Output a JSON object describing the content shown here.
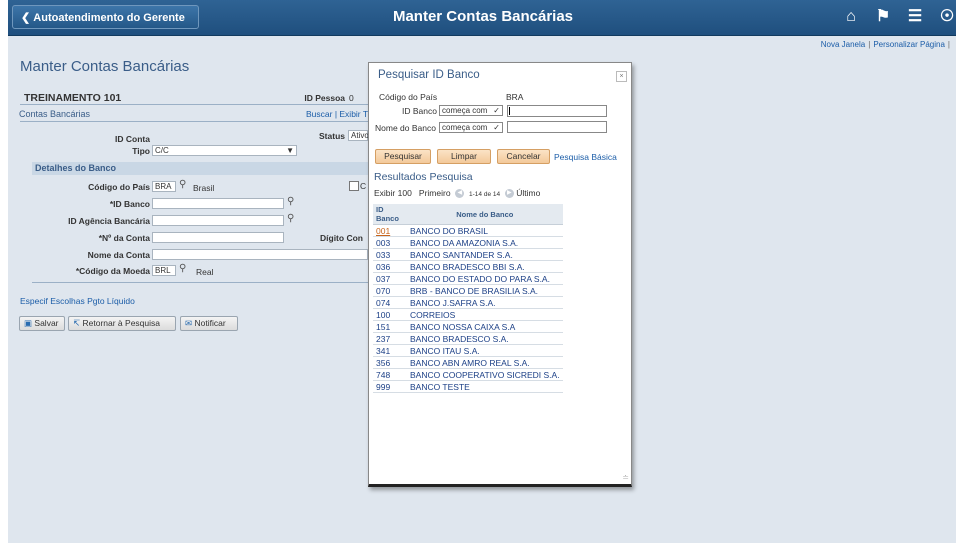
{
  "header": {
    "back_label": "Autoatendimento do Gerente",
    "title": "Manter Contas Bancárias",
    "icons": [
      "home-icon",
      "flag-icon",
      "menu-icon",
      "compass-icon"
    ]
  },
  "toplinks": {
    "new_window": "Nova Janela",
    "personalize": "Personalizar Página"
  },
  "page": {
    "title": "Manter Contas Bancárias",
    "person_name": "TREINAMENTO 101",
    "person_id_label": "ID Pessoa",
    "person_id_value": "0",
    "section_title": "Contas Bancárias",
    "section_links": "Buscar | Exibir T",
    "account_id_label": "ID Conta",
    "status_label": "Status",
    "status_value": "Ativo",
    "type_label": "Tipo",
    "type_value": "C/C",
    "bank_details_title": "Detalhes do Banco",
    "country_label": "Código do País",
    "country_value": "BRA",
    "country_desc": "Brasil",
    "bank_id_label": "*ID Banco",
    "branch_id_label": "ID Agência Bancária",
    "account_no_label": "*Nº da Conta",
    "check_digit_label": "Dígito Con",
    "account_name_label": "Nome da Conta",
    "currency_label": "*Código da Moeda",
    "currency_value": "BRL",
    "currency_desc": "Real",
    "checkbox_label": "C",
    "payment_link": "Especif Escolhas Pgto Líquido",
    "save_label": "Salvar",
    "return_label": "Retornar à Pesquisa",
    "notify_label": "Notificar"
  },
  "modal": {
    "title": "Pesquisar ID Banco",
    "close": "×",
    "country_label": "Código do País",
    "country_value": "BRA",
    "bank_id_label": "ID Banco",
    "bank_id_op": "começa com",
    "bank_name_label": "Nome do Banco",
    "bank_name_op": "começa com",
    "search_btn": "Pesquisar",
    "clear_btn": "Limpar",
    "cancel_btn": "Cancelar",
    "basic_search": "Pesquisa Básica",
    "results_title": "Resultados Pesquisa",
    "show_label": "Exibir 100",
    "first_label": "Primeiro",
    "range_label": "1-14 de 14",
    "last_label": "Último",
    "col_id": "ID Banco",
    "col_name": "Nome do Banco",
    "rows": [
      {
        "id": "001",
        "name": "BANCO DO BRASIL"
      },
      {
        "id": "003",
        "name": "BANCO DA AMAZONIA S.A."
      },
      {
        "id": "033",
        "name": "BANCO SANTANDER S.A."
      },
      {
        "id": "036",
        "name": "BANCO BRADESCO BBI S.A."
      },
      {
        "id": "037",
        "name": "BANCO DO ESTADO DO PARA S.A."
      },
      {
        "id": "070",
        "name": "BRB - BANCO DE BRASILIA S.A."
      },
      {
        "id": "074",
        "name": "BANCO J.SAFRA S.A."
      },
      {
        "id": "100",
        "name": "CORREIOS"
      },
      {
        "id": "151",
        "name": "BANCO NOSSA CAIXA S.A"
      },
      {
        "id": "237",
        "name": "BANCO BRADESCO S.A."
      },
      {
        "id": "341",
        "name": "BANCO ITAU S.A."
      },
      {
        "id": "356",
        "name": "BANCO ABN AMRO REAL S.A."
      },
      {
        "id": "748",
        "name": "BANCO COOPERATIVO SICREDI S.A."
      },
      {
        "id": "999",
        "name": "BANCO TESTE"
      }
    ]
  }
}
